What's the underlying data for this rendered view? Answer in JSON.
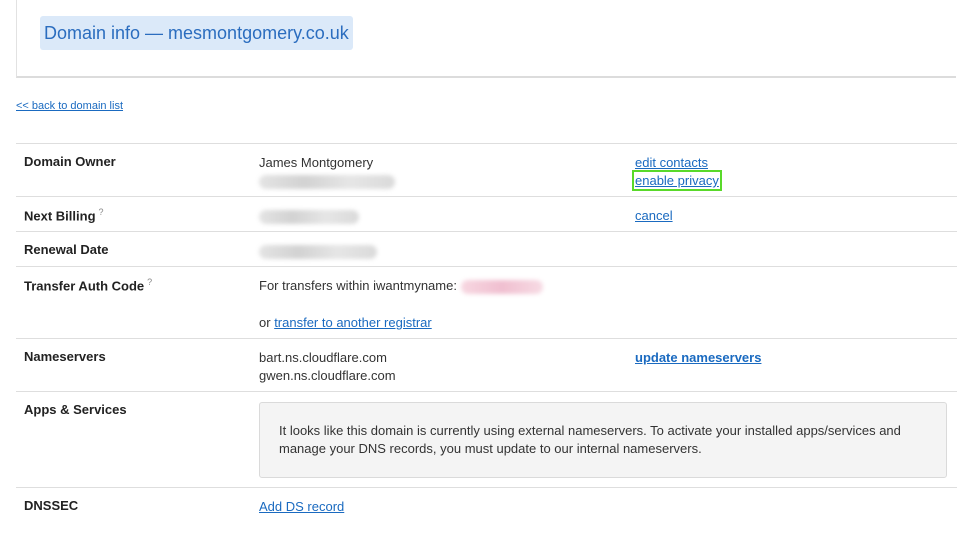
{
  "header": {
    "title": "Domain info — mesmontgomery.co.uk"
  },
  "nav": {
    "back_link": "<< back to domain list"
  },
  "rows": {
    "owner": {
      "label": "Domain Owner",
      "name": "James Montgomery",
      "edit_contacts": "edit contacts",
      "enable_privacy": "enable privacy"
    },
    "billing": {
      "label": "Next Billing",
      "help": "?",
      "cancel": "cancel"
    },
    "renewal": {
      "label": "Renewal Date"
    },
    "transfer": {
      "label": "Transfer Auth Code",
      "help": "?",
      "text": "For transfers within iwantmyname:",
      "or": "or",
      "registrar_link": "transfer to another registrar"
    },
    "nameservers": {
      "label": "Nameservers",
      "ns1": "bart.ns.cloudflare.com",
      "ns2": "gwen.ns.cloudflare.com",
      "update": "update nameservers"
    },
    "apps": {
      "label": "Apps & Services",
      "notice": "It looks like this domain is currently using external nameservers. To activate your installed apps/services and manage your DNS records, you must update to our internal nameservers."
    },
    "dnssec": {
      "label": "DNSSEC",
      "add_ds": "Add DS record"
    }
  },
  "colors": {
    "link": "#1a6ac0",
    "focus_outline": "#59d92a",
    "title_bg": "#dbe9f9",
    "title_text": "#2b6dbf"
  }
}
